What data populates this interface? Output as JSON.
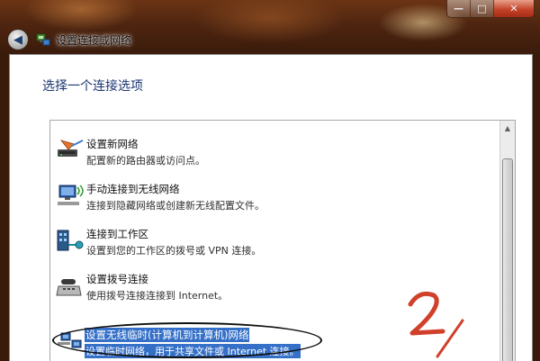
{
  "window": {
    "min_glyph": "—",
    "max_glyph": "□",
    "close_glyph": "✕"
  },
  "wizard": {
    "title": "设置连接或网络",
    "back_glyph": "◀"
  },
  "heading": "选择一个连接选项",
  "options": [
    {
      "title": "设置新网络",
      "desc": "配置新的路由器或访问点。",
      "icon": "router-icon",
      "selected": false
    },
    {
      "title": "手动连接到无线网络",
      "desc": "连接到隐藏网络或创建新无线配置文件。",
      "icon": "wireless-icon",
      "selected": false
    },
    {
      "title": "连接到工作区",
      "desc": "设置到您的工作区的拨号或 VPN 连接。",
      "icon": "workplace-icon",
      "selected": false
    },
    {
      "title": "设置拨号连接",
      "desc": "使用拨号连接连接到 Internet。",
      "icon": "dialup-icon",
      "selected": false
    },
    {
      "title": "设置无线临时(计算机到计算机)网络",
      "desc": "设置临时网络，用于共享文件或 Internet 连接。",
      "icon": "adhoc-icon",
      "selected": true
    }
  ],
  "scroll_up_glyph": "▲",
  "colors": {
    "selection": "#3570c8",
    "heading": "#1a3370",
    "annotation": "#d0402a"
  }
}
